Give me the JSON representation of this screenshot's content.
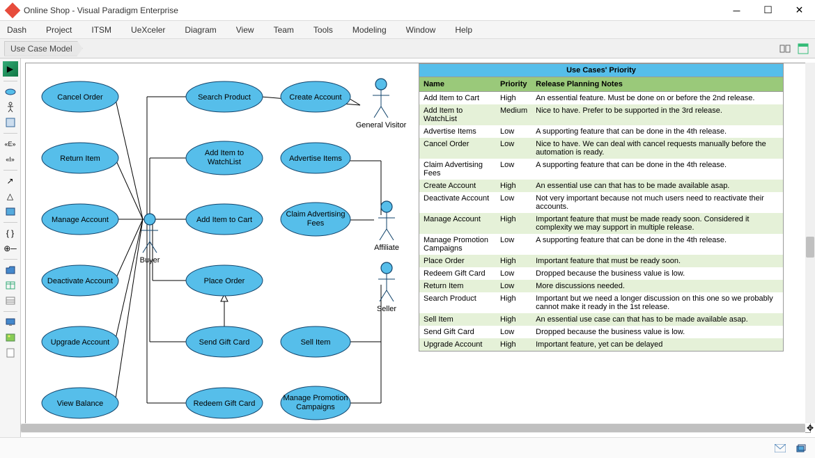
{
  "window": {
    "title": "Online Shop - Visual Paradigm Enterprise"
  },
  "menu": [
    "Dash",
    "Project",
    "ITSM",
    "UeXceler",
    "Diagram",
    "View",
    "Team",
    "Tools",
    "Modeling",
    "Window",
    "Help"
  ],
  "breadcrumb": "Use Case Model",
  "actors": {
    "general_visitor": "General Visitor",
    "buyer": "Buyer",
    "affiliate": "Affiliate",
    "seller": "Seller"
  },
  "usecases": {
    "cancel_order": "Cancel Order",
    "return_item": "Return Item",
    "manage_account": "Manage Account",
    "deactivate_account": "Deactivate Account",
    "upgrade_account": "Upgrade Account",
    "view_balance": "View Balance",
    "search_product": "Search Product",
    "add_item_watchlist_l1": "Add Item to",
    "add_item_watchlist_l2": "WatchList",
    "add_item_cart": "Add Item to Cart",
    "place_order": "Place Order",
    "send_gift_card": "Send Gift Card",
    "redeem_gift_card": "Redeem Gift Card",
    "create_account": "Create Account",
    "advertise_items": "Advertise Items",
    "claim_adv_l1": "Claim Advertising",
    "claim_adv_l2": "Fees",
    "sell_item": "Sell Item",
    "manage_promo_l1": "Manage Promotion",
    "manage_promo_l2": "Campaigns"
  },
  "table": {
    "title": "Use Cases' Priority",
    "headers": {
      "name": "Name",
      "priority": "Priority",
      "notes": "Release Planning Notes"
    },
    "rows": [
      {
        "name": "Add Item to Cart",
        "priority": "High",
        "notes": "An essential feature. Must be done on or before the 2nd release."
      },
      {
        "name": "Add Item to WatchList",
        "priority": "Medium",
        "notes": "Nice to have. Prefer to be supported in the 3rd release."
      },
      {
        "name": "Advertise Items",
        "priority": "Low",
        "notes": "A supporting feature that can be done in the 4th release."
      },
      {
        "name": "Cancel Order",
        "priority": "Low",
        "notes": "Nice to have. We can deal with cancel requests manually before the automation is ready."
      },
      {
        "name": "Claim Advertising Fees",
        "priority": "Low",
        "notes": "A supporting feature that can be done in the 4th release."
      },
      {
        "name": "Create Account",
        "priority": "High",
        "notes": "An essential use can that has to be made available asap."
      },
      {
        "name": "Deactivate Account",
        "priority": "Low",
        "notes": "Not very important because not much users need to reactivate their accounts."
      },
      {
        "name": "Manage Account",
        "priority": "High",
        "notes": "Important feature that must be made ready soon. Considered it complexity we may support in multiple release."
      },
      {
        "name": "Manage Promotion Campaigns",
        "priority": "Low",
        "notes": "A supporting feature that can be done in the 4th release."
      },
      {
        "name": "Place Order",
        "priority": "High",
        "notes": "Important feature that must be ready soon."
      },
      {
        "name": "Redeem Gift Card",
        "priority": "Low",
        "notes": "Dropped because the business value is low."
      },
      {
        "name": "Return Item",
        "priority": "Low",
        "notes": "More discussions needed."
      },
      {
        "name": "Search Product",
        "priority": "High",
        "notes": "Important but we need a longer discussion on this one so we probably cannot make it ready in the 1st release."
      },
      {
        "name": "Sell Item",
        "priority": "High",
        "notes": "An essential use case can that has to be made available asap."
      },
      {
        "name": "Send Gift Card",
        "priority": "Low",
        "notes": "Dropped because the business value is low."
      },
      {
        "name": "Upgrade Account",
        "priority": "High",
        "notes": "Important feature, yet can be delayed"
      }
    ]
  }
}
